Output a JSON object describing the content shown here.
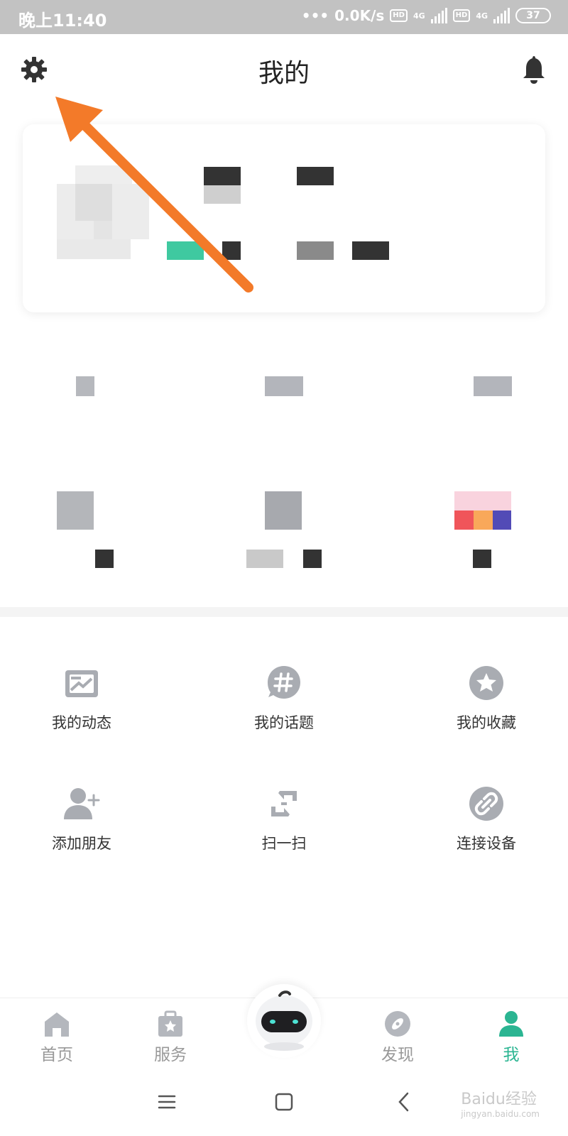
{
  "status_bar": {
    "time": "晚上11:40",
    "speed": "0.0K/s",
    "hd1": "HD",
    "hd2": "HD",
    "network1": "4G",
    "network2": "4G",
    "battery": "37"
  },
  "header": {
    "title": "我的",
    "settings_icon": "gear-icon",
    "bell_icon": "bell-icon"
  },
  "menu": [
    {
      "label": "我的动态",
      "icon": "post-icon"
    },
    {
      "label": "我的话题",
      "icon": "hashtag-icon"
    },
    {
      "label": "我的收藏",
      "icon": "star-icon"
    },
    {
      "label": "添加朋友",
      "icon": "add-friend-icon"
    },
    {
      "label": "扫一扫",
      "icon": "scan-icon"
    },
    {
      "label": "连接设备",
      "icon": "link-icon"
    }
  ],
  "bottom_nav": [
    {
      "label": "首页",
      "icon": "home-icon"
    },
    {
      "label": "服务",
      "icon": "briefcase-icon"
    },
    {
      "label": "",
      "icon": "robot-icon"
    },
    {
      "label": "发现",
      "icon": "compass-icon"
    },
    {
      "label": "我",
      "icon": "person-icon",
      "active": true
    }
  ],
  "system_nav": {
    "watermark": "Baidu经验",
    "watermark_sub": "jingyan.baidu.com"
  },
  "colors": {
    "accent": "#2bb592",
    "arrow": "#f37a29",
    "icon_gray": "#a9acb2",
    "status_bar": "#c2c2c2"
  }
}
